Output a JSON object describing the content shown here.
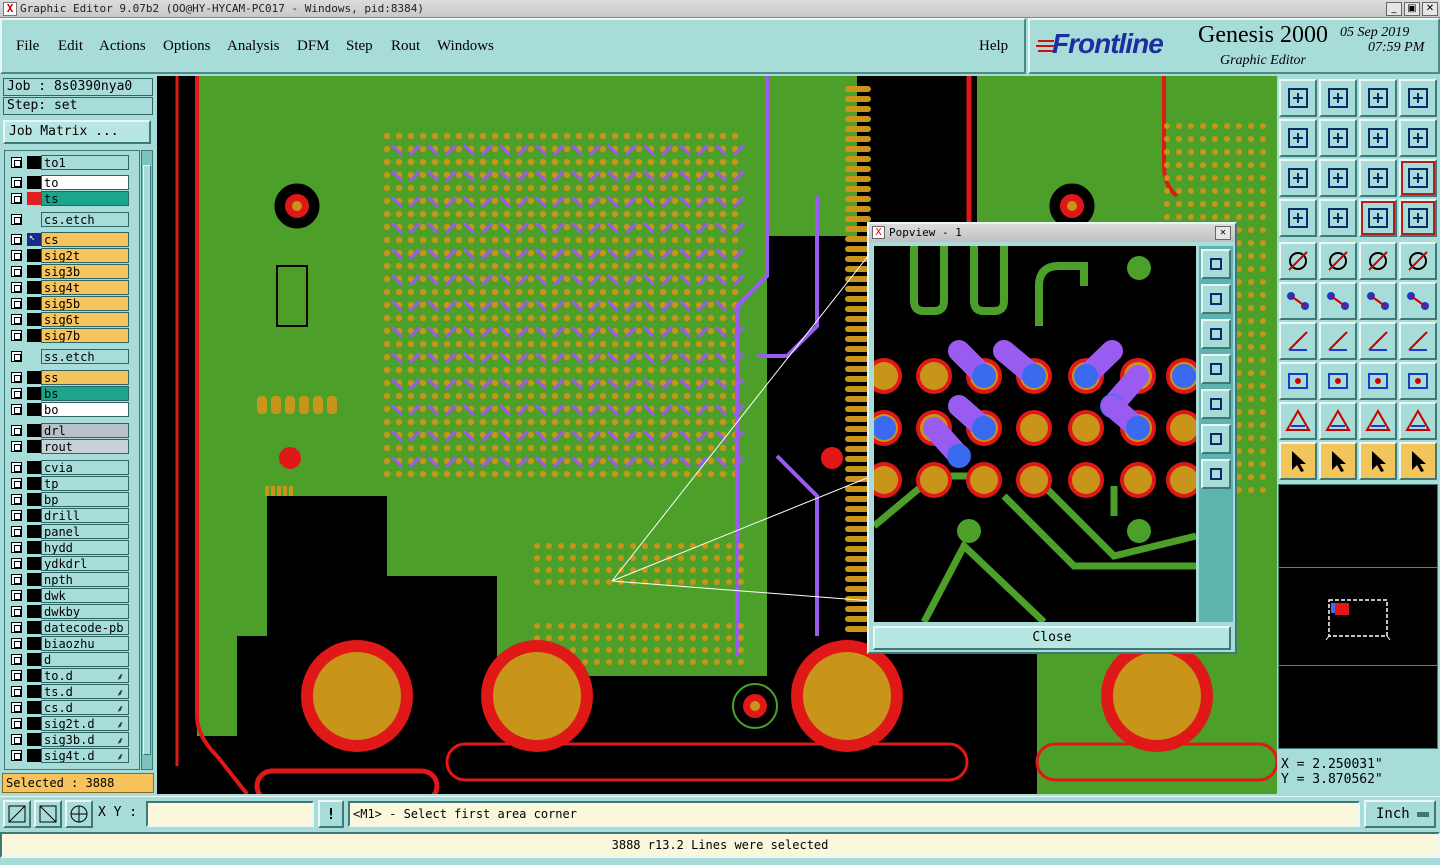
{
  "window": {
    "title": "Graphic Editor 9.07b2 (OO@HY-HYCAM-PC017 - Windows, pid:8384)",
    "app_icon": "x-logo-icon",
    "controls": [
      "_",
      "▣",
      "✕"
    ]
  },
  "menubar": {
    "items": [
      "File",
      "Edit",
      "Actions",
      "Options",
      "Analysis",
      "DFM",
      "Step",
      "Rout",
      "Windows"
    ],
    "help": "Help"
  },
  "branding": {
    "logo": "Frontline",
    "product": "Genesis 2000",
    "subtitle": "Graphic Editor",
    "date": "05 Sep 2019",
    "time": "07:59 PM"
  },
  "left_panel": {
    "job": "Job : 8s0390nya0",
    "step": "Step: set",
    "job_matrix_label": "Job Matrix ...",
    "layers": [
      {
        "name": "to1",
        "bg": "#a8dcd9",
        "swatch": "#000000"
      },
      {
        "name": "to",
        "bg": "#ffffff",
        "swatch": "#000000"
      },
      {
        "name": "ts",
        "bg": "#1aa58c",
        "swatch": "#e02020"
      },
      {
        "name": "cs.etch",
        "bg": "#a8dcd9",
        "swatch": ""
      },
      {
        "name": "cs",
        "bg": "#f7c35d",
        "swatch": "#1a2a8a",
        "active": true
      },
      {
        "name": "sig2t",
        "bg": "#f7c35d",
        "swatch": "#000000"
      },
      {
        "name": "sig3b",
        "bg": "#f7c35d",
        "swatch": "#000000"
      },
      {
        "name": "sig4t",
        "bg": "#f7c35d",
        "swatch": "#000000"
      },
      {
        "name": "sig5b",
        "bg": "#f7c35d",
        "swatch": "#000000"
      },
      {
        "name": "sig6t",
        "bg": "#f7c35d",
        "swatch": "#000000"
      },
      {
        "name": "sig7b",
        "bg": "#f7c35d",
        "swatch": "#000000"
      },
      {
        "name": "ss.etch",
        "bg": "#a8dcd9",
        "swatch": ""
      },
      {
        "name": "ss",
        "bg": "#f7c35d",
        "swatch": "#000000"
      },
      {
        "name": "bs",
        "bg": "#1aa58c",
        "swatch": "#000000"
      },
      {
        "name": "bo",
        "bg": "#ffffff",
        "swatch": "#000000"
      },
      {
        "name": "drl",
        "bg": "#b8c0c8",
        "swatch": "#000000"
      },
      {
        "name": "rout",
        "bg": "#c8d0d8",
        "swatch": "#000000"
      },
      {
        "name": "cvia",
        "bg": "#a8dcd9",
        "swatch": "#000000"
      },
      {
        "name": "tp",
        "bg": "#a8dcd9",
        "swatch": "#000000"
      },
      {
        "name": "bp",
        "bg": "#a8dcd9",
        "swatch": "#000000"
      },
      {
        "name": "drill",
        "bg": "#a8dcd9",
        "swatch": "#000000"
      },
      {
        "name": "panel",
        "bg": "#a8dcd9",
        "swatch": "#000000"
      },
      {
        "name": "hydd",
        "bg": "#a8dcd9",
        "swatch": "#000000"
      },
      {
        "name": "ydkdrl",
        "bg": "#a8dcd9",
        "swatch": "#000000"
      },
      {
        "name": "npth",
        "bg": "#a8dcd9",
        "swatch": "#000000"
      },
      {
        "name": "dwk",
        "bg": "#a8dcd9",
        "swatch": "#000000"
      },
      {
        "name": "dwkby",
        "bg": "#a8dcd9",
        "swatch": "#000000"
      },
      {
        "name": "datecode-pb",
        "bg": "#a8dcd9",
        "swatch": "#000000"
      },
      {
        "name": "biaozhu",
        "bg": "#a8dcd9",
        "swatch": "#000000"
      },
      {
        "name": "d",
        "bg": "#a8dcd9",
        "swatch": "#000000"
      },
      {
        "name": "to.d",
        "bg": "#a8dcd9",
        "swatch": "#000000",
        "mark": "⸙"
      },
      {
        "name": "ts.d",
        "bg": "#a8dcd9",
        "swatch": "#000000",
        "mark": "⸙"
      },
      {
        "name": "cs.d",
        "bg": "#a8dcd9",
        "swatch": "#000000",
        "mark": "⸙"
      },
      {
        "name": "sig2t.d",
        "bg": "#a8dcd9",
        "swatch": "#000000",
        "mark": "⸙"
      },
      {
        "name": "sig3b.d",
        "bg": "#a8dcd9",
        "swatch": "#000000",
        "mark": "⸙"
      },
      {
        "name": "sig4t.d",
        "bg": "#a8dcd9",
        "swatch": "#000000",
        "mark": "⸙"
      }
    ],
    "selected": "Selected : 3888"
  },
  "popview": {
    "title": "Popview - 1",
    "close_label": "Close",
    "tools": [
      "zoom-fit-icon",
      "pan-up-icon",
      "pan-down-icon",
      "pan-left-icon",
      "pan-right-icon",
      "zoom-in-icon",
      "zoom-out-icon"
    ]
  },
  "toolbox": {
    "buttons": [
      "pan-up-icon",
      "pan-down-icon",
      "home-icon",
      "window-icon",
      "pan-left-icon",
      "pan-right-icon",
      "undo-icon",
      "redo-icon",
      "zoom-fit-icon",
      "zoom-center-icon",
      "scale-icon",
      "help-icon",
      "snap-icon",
      "measure-icon",
      "layer-a-icon",
      "layer-b-icon",
      "select-pad-icon",
      "feature-icon",
      "ruler-icon",
      "circle-icon",
      "connect-icon",
      "cross-icon",
      "move-icon",
      "rotate-icon",
      "line-icon",
      "diag-line-icon",
      "arc-icon",
      "text-icon",
      "pad-icon",
      "dash-icon",
      "frame-icon",
      "group-icon",
      "triangle-icon",
      "triangle-2-icon",
      "triangle-3-icon",
      "triangle-4-icon",
      "pointer-icon",
      "pointer-2-icon",
      "pointer-3-icon",
      "pointer-4-icon"
    ]
  },
  "coords": {
    "x": "X = 2.250031\"",
    "y": "Y = 3.870562\""
  },
  "bottombar": {
    "xy_label": "X Y :",
    "xy_value": "",
    "warn": "!",
    "prompt": "<M1> - Select first area corner",
    "units": "Inch"
  },
  "status": "3888 r13.2 Lines were selected",
  "colors": {
    "panel_bg": "#a8dcd9",
    "copper_fill": "#4ca02a",
    "pad": "#c8941a",
    "via_ring": "#e01818",
    "trace": "#9a5cf0",
    "highlight_blue": "#3a6af0"
  }
}
